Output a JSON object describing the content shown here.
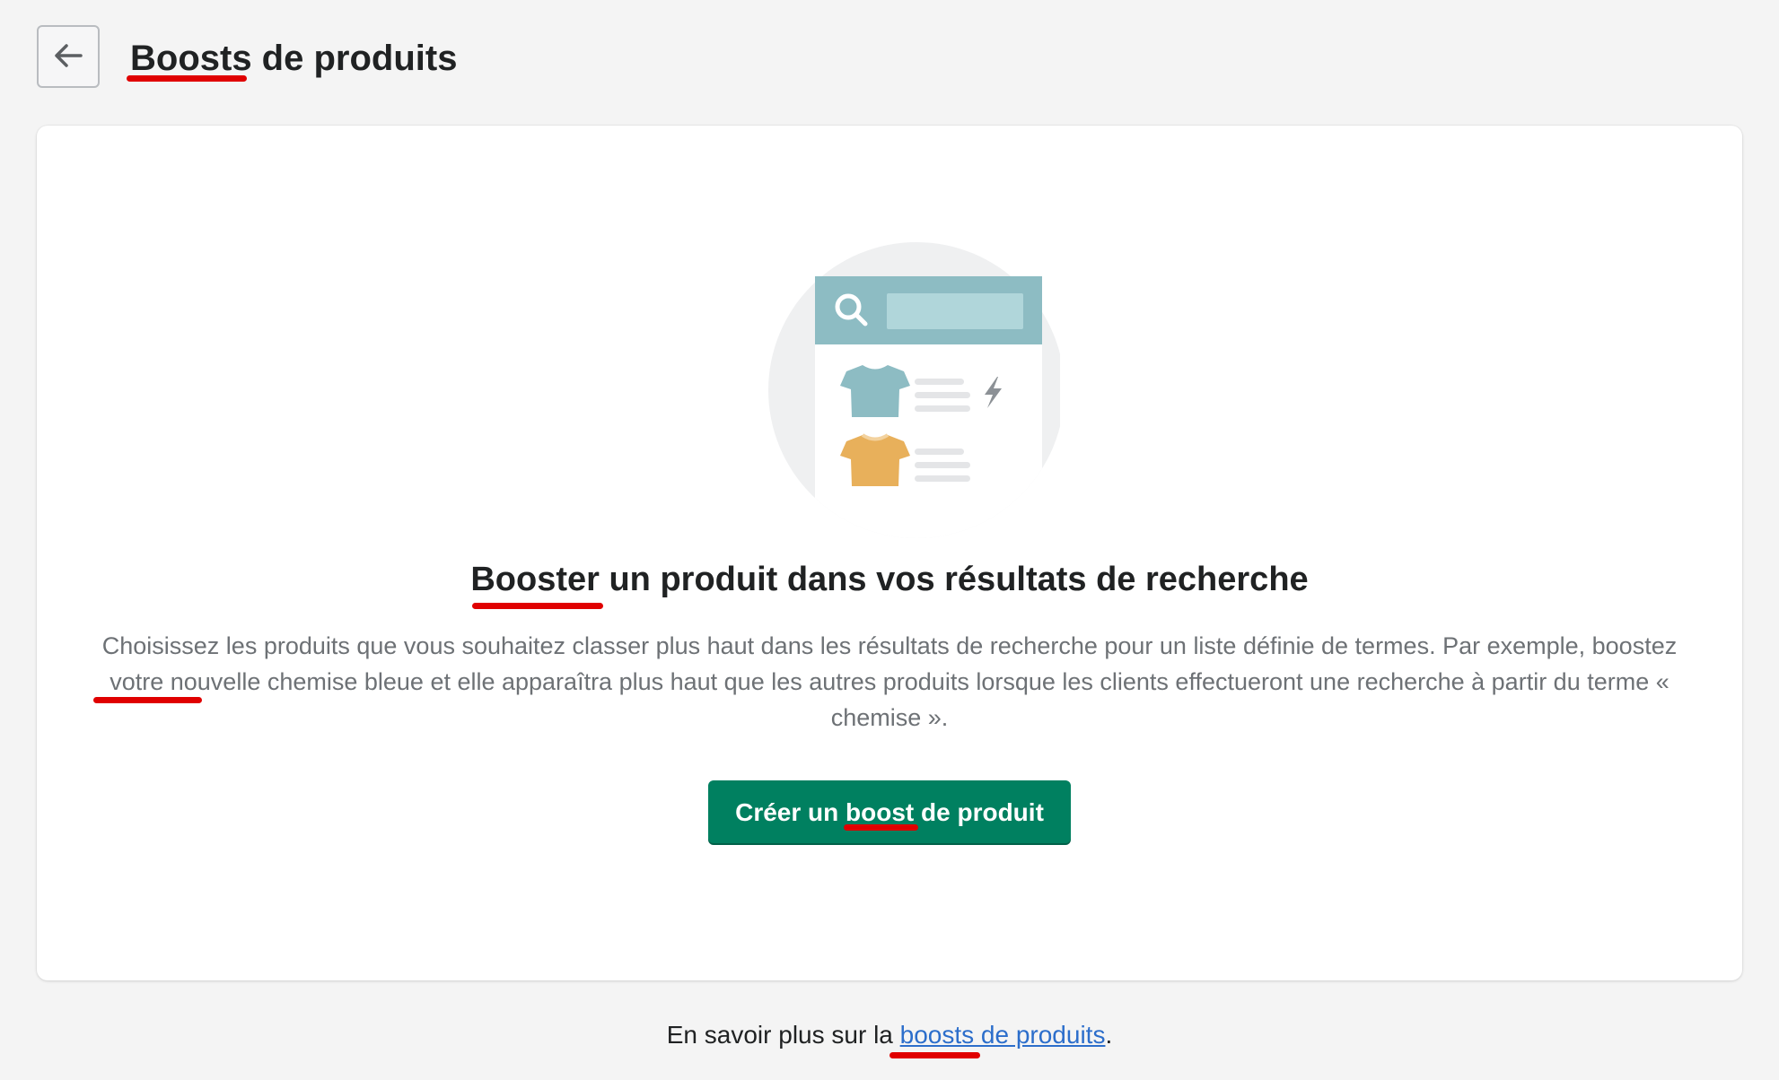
{
  "header": {
    "title": "Boosts de produits",
    "back_icon": "arrow-left-icon"
  },
  "empty_state": {
    "illustration": "search-results-boost-illustration",
    "title": "Booster un produit dans vos résultats de recherche",
    "description": "Choisissez les produits que vous souhaitez classer plus haut dans les résultats de recherche pour un liste définie de termes. Par exemple, boostez votre nouvelle chemise bleue et elle apparaîtra plus haut que les autres produits lorsque les clients effectueront une recherche à partir du terme « chemise ».",
    "cta_label": "Créer un boost de produit"
  },
  "footer": {
    "text_before": "En savoir plus sur la ",
    "link_label": "boosts de produits",
    "text_after": "."
  },
  "colors": {
    "primary_button": "#008060",
    "link": "#2c6ecb",
    "annotation": "#e00000"
  }
}
